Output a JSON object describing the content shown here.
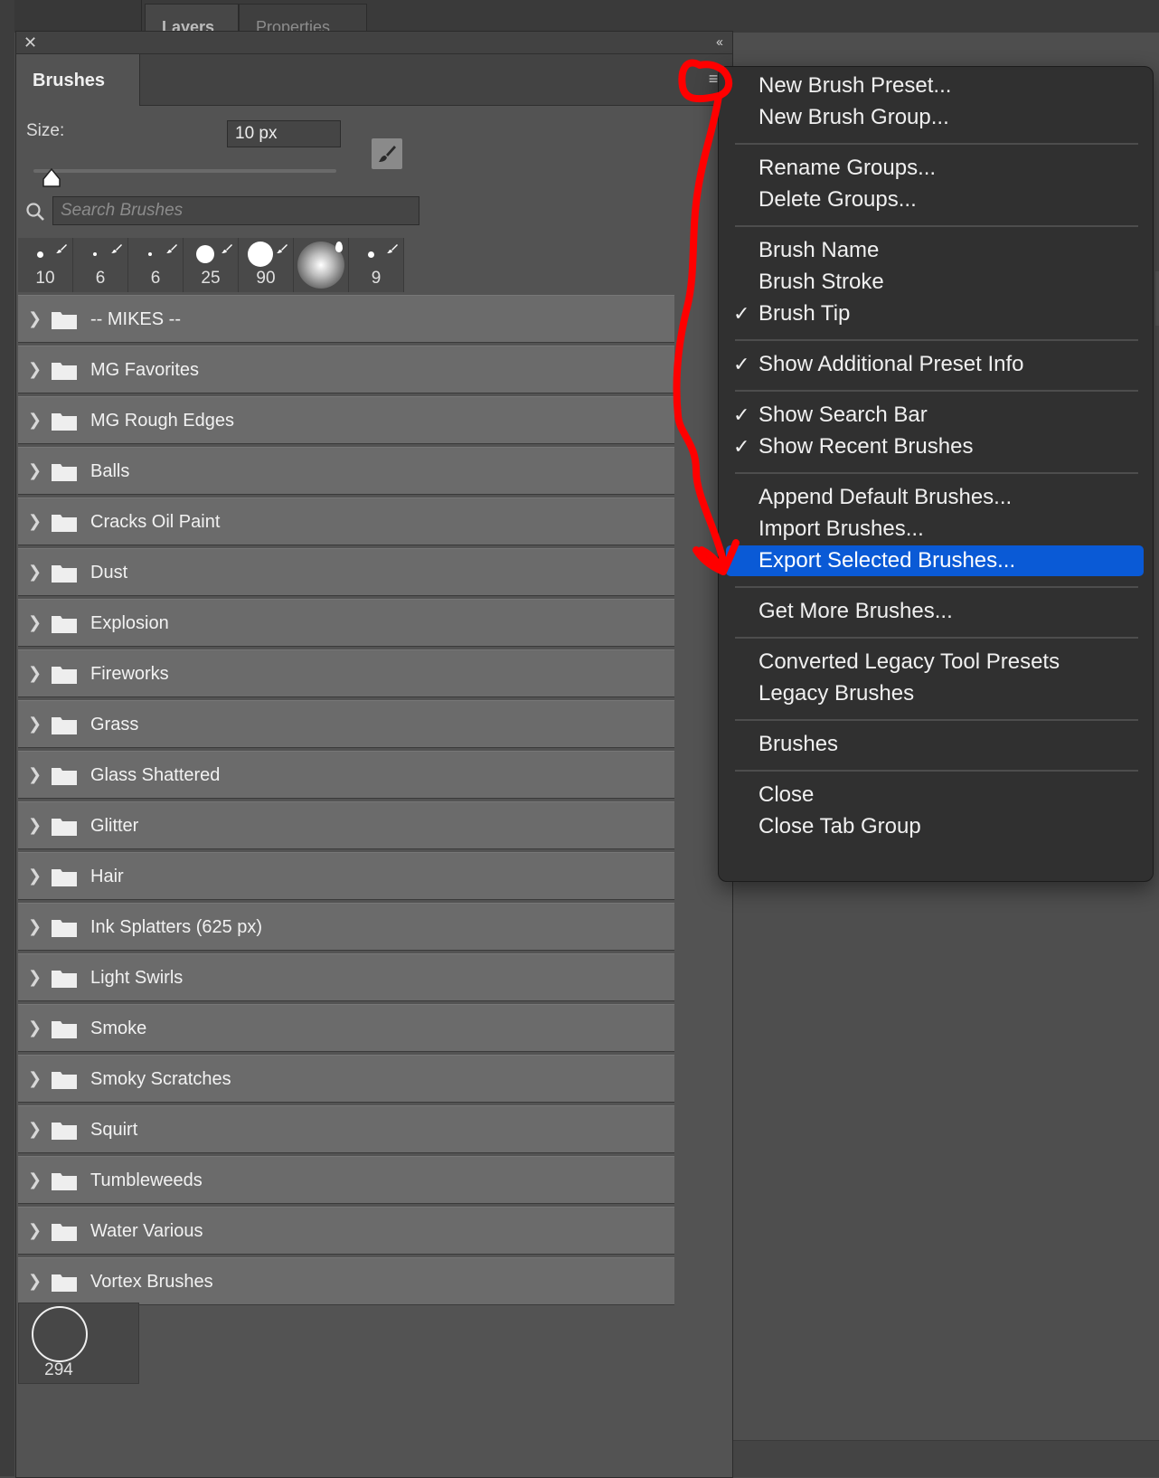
{
  "background": {
    "tabs": [
      "Layers",
      "Properties"
    ]
  },
  "panel": {
    "tab_title": "Brushes",
    "size_label": "Size:",
    "size_value": "10 px",
    "size_slider_fraction": 0.03,
    "search_placeholder": "Search Brushes",
    "recent_brushes": [
      {
        "size": "10",
        "kind": "dot"
      },
      {
        "size": "6",
        "kind": "dot"
      },
      {
        "size": "6",
        "kind": "dot"
      },
      {
        "size": "25",
        "kind": "dot"
      },
      {
        "size": "90",
        "kind": "dot"
      },
      {
        "size": "",
        "kind": "soft"
      },
      {
        "size": "9",
        "kind": "dot"
      }
    ],
    "groups": [
      "-- MIKES --",
      "MG Favorites",
      "MG Rough Edges",
      "Balls",
      "Cracks Oil Paint",
      "Dust",
      "Explosion",
      "Fireworks",
      "Grass",
      "Glass Shattered",
      "Glitter",
      "Hair",
      "Ink Splatters (625 px)",
      "Light Swirls",
      "Smoke",
      "Smoky Scratches",
      "Squirt",
      "Tumbleweeds",
      "Water Various",
      "Vortex Brushes"
    ],
    "bottom_brush_size": "294"
  },
  "menu": {
    "check_glyph": "✓",
    "sections": [
      [
        {
          "label": "New Brush Preset...",
          "checked": false
        },
        {
          "label": "New Brush Group...",
          "checked": false
        }
      ],
      [
        {
          "label": "Rename Groups...",
          "checked": false
        },
        {
          "label": "Delete Groups...",
          "checked": false
        }
      ],
      [
        {
          "label": "Brush Name",
          "checked": false
        },
        {
          "label": "Brush Stroke",
          "checked": false
        },
        {
          "label": "Brush Tip",
          "checked": true
        }
      ],
      [
        {
          "label": "Show Additional Preset Info",
          "checked": true
        }
      ],
      [
        {
          "label": "Show Search Bar",
          "checked": true
        },
        {
          "label": "Show Recent Brushes",
          "checked": true
        }
      ],
      [
        {
          "label": "Append Default Brushes...",
          "checked": false
        },
        {
          "label": "Import Brushes...",
          "checked": false
        },
        {
          "label": "Export Selected Brushes...",
          "checked": false,
          "highlighted": true
        }
      ],
      [
        {
          "label": "Get More Brushes...",
          "checked": false
        }
      ],
      [
        {
          "label": "Converted Legacy Tool Presets",
          "checked": false
        },
        {
          "label": "Legacy Brushes",
          "checked": false
        }
      ],
      [
        {
          "label": "Brushes",
          "checked": false
        }
      ],
      [
        {
          "label": "Close",
          "checked": false
        },
        {
          "label": "Close Tab Group",
          "checked": false
        }
      ]
    ]
  },
  "colors": {
    "highlight": "#0a5ad6",
    "annotation": "#ff0000"
  }
}
